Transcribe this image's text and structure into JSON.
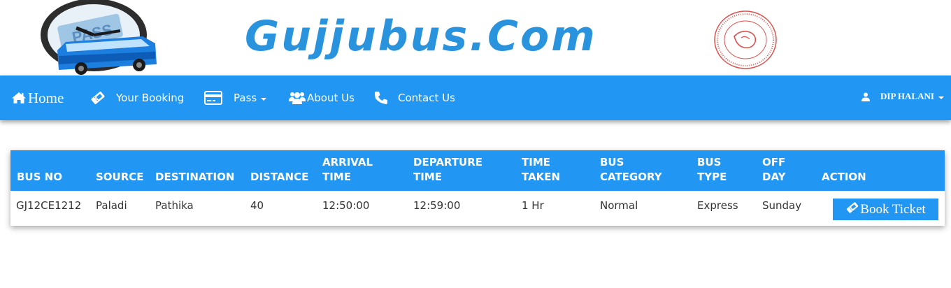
{
  "brand": {
    "name": "Gujjubus.Com"
  },
  "nav": {
    "home": "Home",
    "booking": "Your Booking",
    "pass": "Pass",
    "about": "About Us",
    "contact": "Contact Us",
    "user": "DIP HALANI"
  },
  "table": {
    "headers": [
      "BUS NO",
      "SOURCE",
      "DESTINATION",
      "DISTANCE",
      "ARRIVAL\nTIME",
      "DEPARTURE\nTIME",
      "TIME\nTAKEN",
      "BUS\nCATEGORY",
      "BUS\nTYPE",
      "OFF\nDAY",
      "ACTION"
    ],
    "rows": [
      {
        "bus_no": "GJ12CE1212",
        "source": "Paladi",
        "destination": "Pathika",
        "distance": "40",
        "arrival_time": "12:50:00",
        "departure_time": "12:59:00",
        "time_taken": "1 Hr",
        "bus_category": "Normal",
        "bus_type": "Express",
        "off_day": "Sunday",
        "action_label": "Book Ticket"
      }
    ]
  },
  "colors": {
    "primary": "#2196f3",
    "brand_text": "#2a93de",
    "emblem_red": "#d9534f"
  },
  "icons": {
    "home": "home-icon",
    "booking": "ticket-icon",
    "pass": "credit-card-icon",
    "about": "users-icon",
    "contact": "phone-icon",
    "user": "user-icon"
  }
}
